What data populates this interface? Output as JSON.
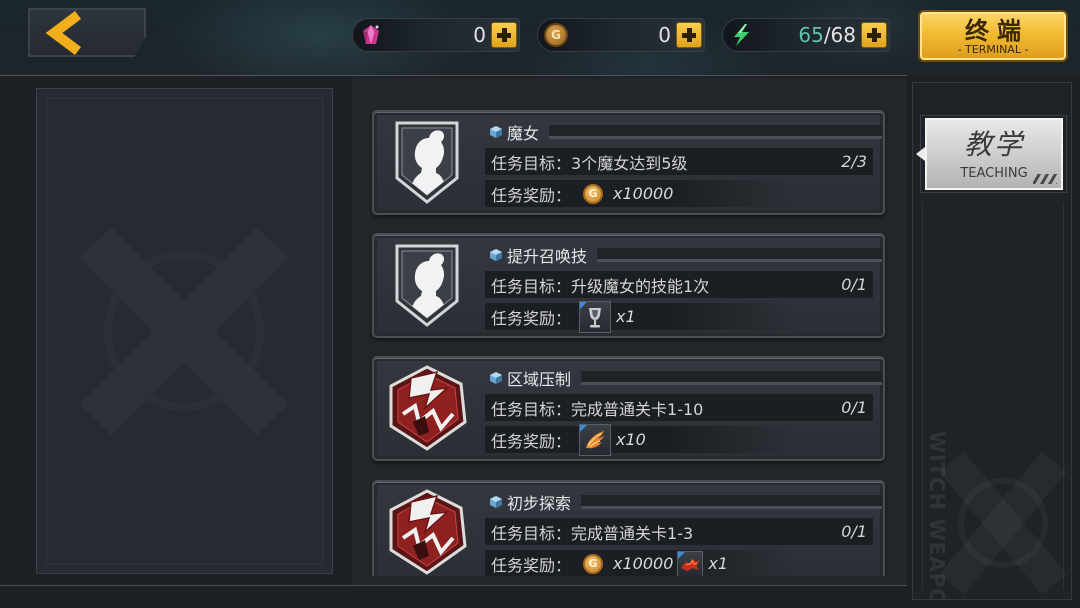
{
  "header": {
    "resources": [
      {
        "icon": "pink-crystal-icon",
        "value": "0"
      },
      {
        "icon": "gold-coin-icon",
        "glyph": "G",
        "value": "0"
      },
      {
        "icon": "green-lightning-icon",
        "current": "65",
        "max": "/68"
      }
    ],
    "terminal": {
      "label": "终端",
      "sublabel": "- TERMINAL -"
    }
  },
  "missions": [
    {
      "badge_icon": "witch-silhouette-shield-icon",
      "title": "魔女",
      "objective_label": "任务目标：",
      "objective": "3个魔女达到5级",
      "progress": "2/3",
      "reward_label": "任务奖励：",
      "rewards": [
        {
          "icon": "gold-coin-icon",
          "glyph": "G",
          "amount": "x10000"
        }
      ]
    },
    {
      "badge_icon": "witch-silhouette-shield-icon",
      "title": "提升召唤技",
      "objective_label": "任务目标：",
      "objective": "升级魔女的技能1次",
      "progress": "0/1",
      "reward_label": "任务奖励：",
      "rewards": [
        {
          "icon": "chalice-item-icon",
          "amount": "x1"
        }
      ]
    },
    {
      "badge_icon": "red-crest-icon",
      "title": "区域压制",
      "objective_label": "任务目标：",
      "objective": "完成普通关卡1-10",
      "progress": "0/1",
      "reward_label": "任务奖励：",
      "rewards": [
        {
          "icon": "wings-item-icon",
          "amount": "x10"
        }
      ]
    },
    {
      "badge_icon": "red-crest-icon",
      "title": "初步探索",
      "objective_label": "任务目标：",
      "objective": "完成普通关卡1-3",
      "progress": "0/1",
      "reward_label": "任务奖励：",
      "rewards": [
        {
          "icon": "gold-coin-icon",
          "glyph": "G",
          "amount": "x10000"
        },
        {
          "icon": "red-beast-item-icon",
          "amount": "x1"
        }
      ]
    }
  ],
  "side_tab": {
    "label": "教学",
    "sublabel": "TEACHING"
  },
  "watermark": "WITCH WEAPON",
  "colors": {
    "accent_gold": "#f2b82a",
    "stamina_green": "#3fcf6d",
    "stamina_value": "#5fc3ad",
    "crystal_pink": "#d63d9b",
    "card_bg": "#2f3339",
    "text": "#d4d4d4",
    "tab_bg": "#d0d0d0"
  }
}
